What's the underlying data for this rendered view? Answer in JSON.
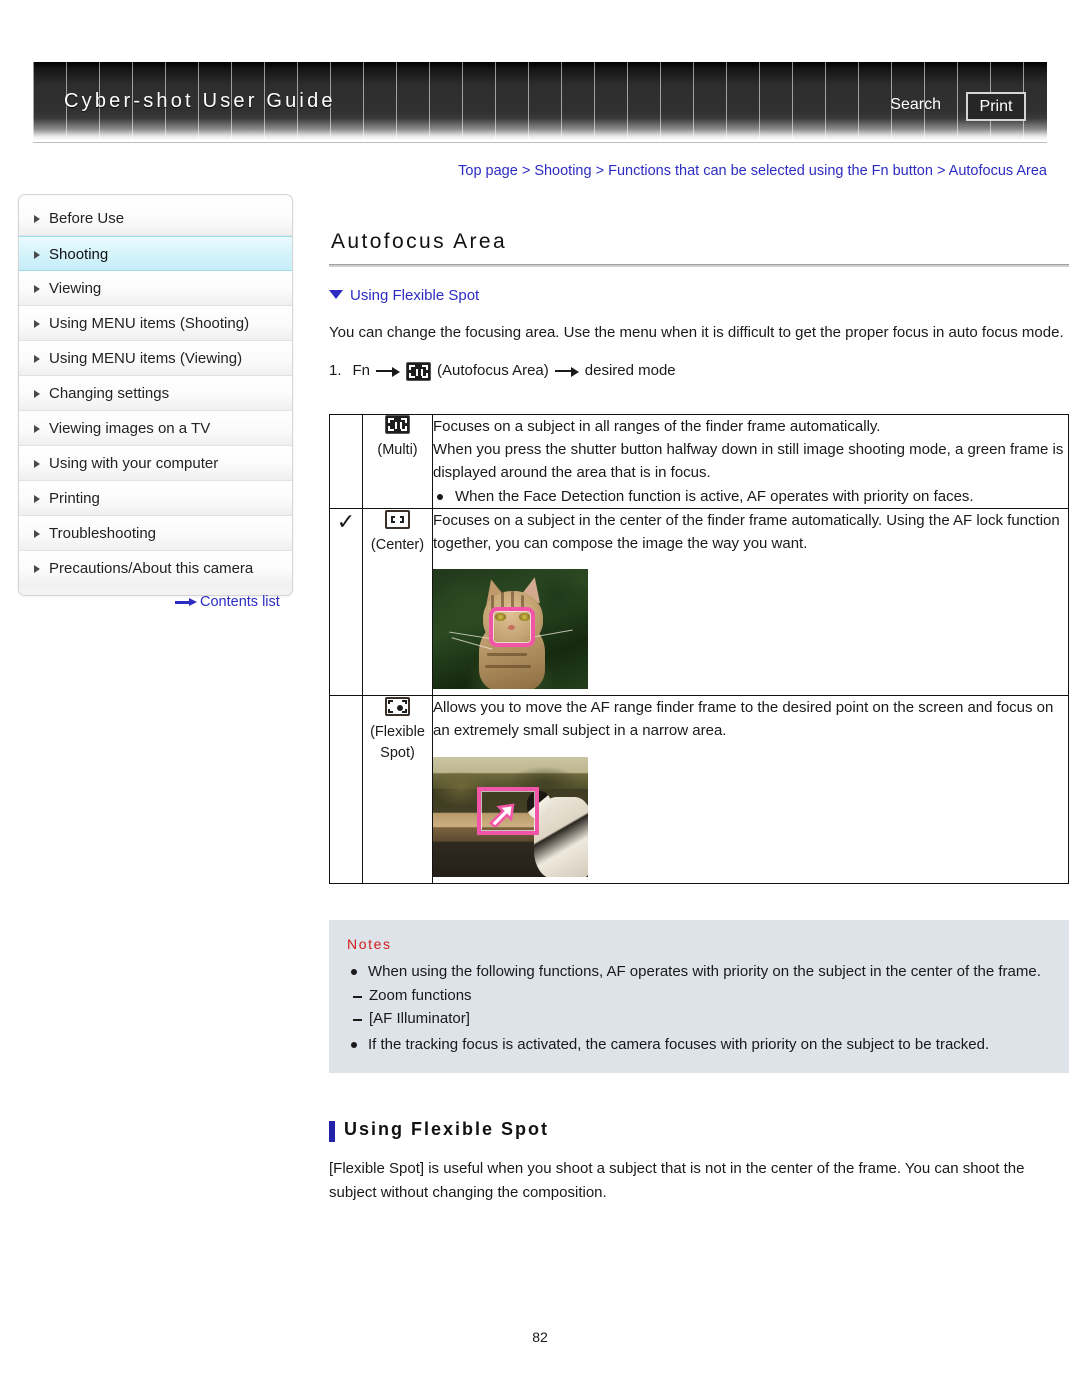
{
  "header": {
    "title": "Cyber-shot User Guide",
    "search_label": "Search",
    "print_label": "Print"
  },
  "breadcrumb": {
    "text": "Top page > Shooting > Functions that can be selected using the Fn button > Autofocus Area"
  },
  "sidebar": {
    "items": [
      {
        "label": "Before Use",
        "active": false
      },
      {
        "label": "Shooting",
        "active": true
      },
      {
        "label": "Viewing",
        "active": false
      },
      {
        "label": "Using MENU items (Shooting)",
        "active": false
      },
      {
        "label": "Using MENU items (Viewing)",
        "active": false
      },
      {
        "label": "Changing settings",
        "active": false
      },
      {
        "label": "Viewing images on a TV",
        "active": false
      },
      {
        "label": "Using with your computer",
        "active": false
      },
      {
        "label": "Printing",
        "active": false
      },
      {
        "label": "Troubleshooting",
        "active": false
      },
      {
        "label": "Precautions/About this camera",
        "active": false
      }
    ],
    "contents_link": "Contents list"
  },
  "main": {
    "page_title": "Autofocus Area",
    "jump_link": "Using Flexible Spot",
    "intro": "You can change the focusing area. Use the menu when it is difficult to get the proper focus in auto focus mode.",
    "step": {
      "number": "1.",
      "first": "Fn",
      "icon_label": "(Autofocus Area)",
      "last": "desired mode"
    },
    "table": {
      "rows": [
        {
          "checked": "",
          "icon": "af-multi-icon",
          "icon_label": "(Multi)",
          "desc_lines": [
            "Focuses on a subject in all ranges of the finder frame automatically.",
            "When you press the shutter button halfway down in still image shooting mode, a green frame is displayed around the area that is in focus."
          ],
          "bullets": [
            "When the Face Detection function is active, AF operates with priority on faces."
          ],
          "photo": ""
        },
        {
          "checked": "✓",
          "icon": "af-center-icon",
          "icon_label": "(Center)",
          "desc_lines": [
            "Focuses on a subject in the center of the finder frame automatically. Using the AF lock function together, you can compose the image the way you want."
          ],
          "bullets": [],
          "photo": "cat-face-with-af-frame"
        },
        {
          "checked": "",
          "icon": "af-flexible-spot-icon",
          "icon_label_1": "(Flexible",
          "icon_label_2": "Spot)",
          "desc_lines": [
            "Allows you to move the AF range finder frame to the desired point on the screen and focus on an extremely small subject in a narrow area."
          ],
          "bullets": [],
          "photo": "scene-with-af-frame-and-cursor"
        }
      ]
    },
    "notes": {
      "title": "Notes",
      "items": [
        "When using the following functions, AF operates with priority on the subject in the center of the frame.",
        "If the tracking focus is activated, the camera focuses with priority on the subject to be tracked."
      ],
      "sub_items": [
        "Zoom functions",
        "[AF Illuminator]"
      ]
    },
    "section": {
      "heading": "Using Flexible Spot",
      "body": "[Flexible Spot] is useful when you shoot a subject that is not in the center of the frame. You can shoot the subject without changing the composition."
    }
  },
  "footer": {
    "page_number": "82"
  },
  "colors": {
    "link": "#2c2cc4",
    "active_nav": "#c6edf8",
    "notes_bg": "#dde3e9",
    "notes_title": "#d01e1e",
    "af_frame": "#f255a8",
    "section_marker": "#2222aa"
  }
}
